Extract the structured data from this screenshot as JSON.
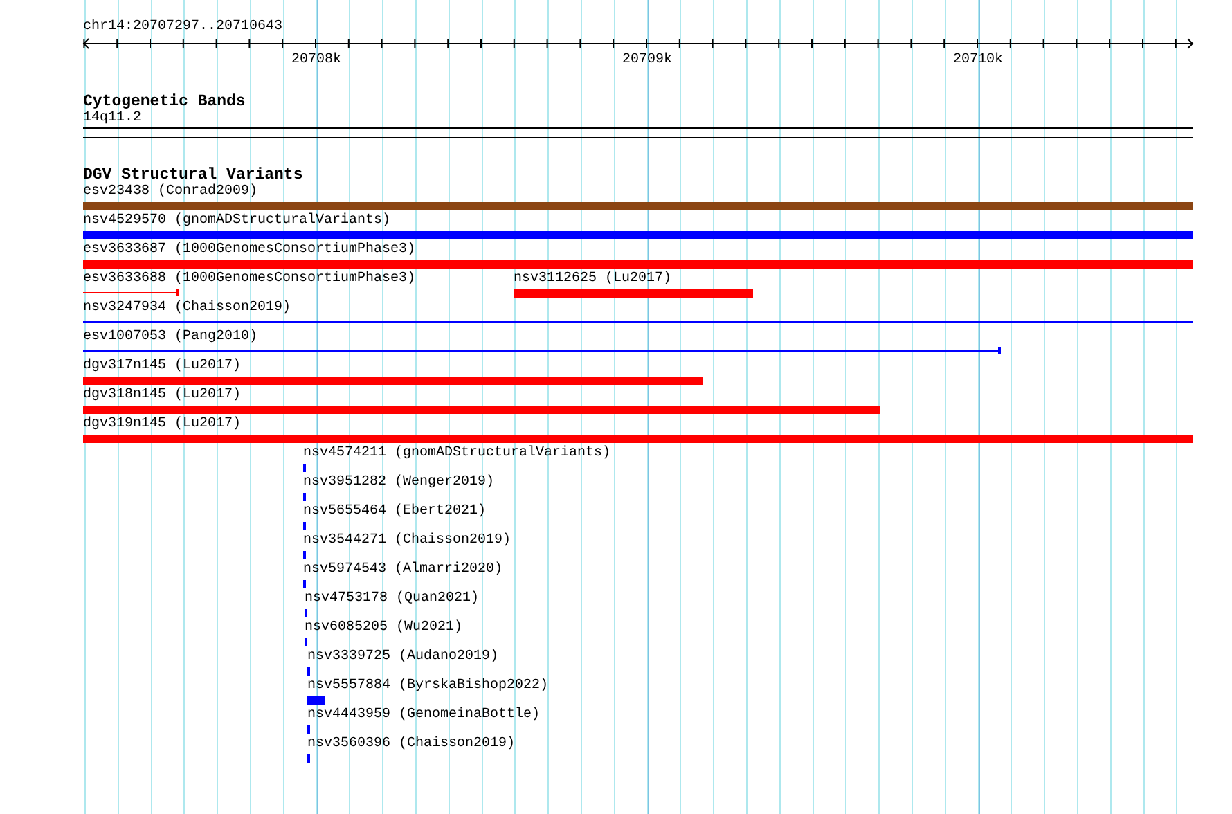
{
  "ruler": {
    "region": "chr14:20707297..20710643",
    "ticks": [
      {
        "label": "20708k"
      },
      {
        "label": "20709k"
      },
      {
        "label": "20710k"
      }
    ]
  },
  "cytogenetic_bands": {
    "title": "Cytogenetic Bands",
    "bands": [
      {
        "label": "14q11.2"
      }
    ]
  },
  "dgv_track": {
    "title": "DGV Structural Variants",
    "rows": [
      {
        "features": [
          {
            "label": "esv23438 (Conrad2009)",
            "kind": "thick",
            "color": "#8b4513"
          }
        ]
      },
      {
        "features": [
          {
            "label": "nsv4529570 (gnomADStructuralVariants)",
            "kind": "thick",
            "color": "#0000ff"
          }
        ]
      },
      {
        "features": [
          {
            "label": "esv3633687 (1000GenomesConsortiumPhase3)",
            "kind": "thick",
            "color": "#ff0000"
          }
        ]
      },
      {
        "features": [
          {
            "label": "esv3633688 (1000GenomesConsortiumPhase3)",
            "kind": "thin",
            "color": "#ff0000"
          },
          {
            "label": "nsv3112625 (Lu2017)",
            "kind": "thick",
            "color": "#ff0000"
          }
        ]
      },
      {
        "features": [
          {
            "label": "nsv3247934 (Chaisson2019)",
            "kind": "thin",
            "color": "#0000ff"
          }
        ]
      },
      {
        "features": [
          {
            "label": "esv1007053 (Pang2010)",
            "kind": "thin",
            "color": "#0000ff"
          }
        ]
      },
      {
        "features": [
          {
            "label": "dgv317n145 (Lu2017)",
            "kind": "thick",
            "color": "#ff0000"
          }
        ]
      },
      {
        "features": [
          {
            "label": "dgv318n145 (Lu2017)",
            "kind": "thick",
            "color": "#ff0000"
          }
        ]
      },
      {
        "features": [
          {
            "label": "dgv319n145 (Lu2017)",
            "kind": "thick",
            "color": "#ff0000"
          }
        ]
      },
      {
        "features": [
          {
            "label": "nsv4574211 (gnomADStructuralVariants)",
            "kind": "thick",
            "color": "#0000ff"
          }
        ]
      },
      {
        "features": [
          {
            "label": "nsv3951282 (Wenger2019)",
            "kind": "thick",
            "color": "#0000ff"
          }
        ]
      },
      {
        "features": [
          {
            "label": "nsv5655464 (Ebert2021)",
            "kind": "thick",
            "color": "#0000ff"
          }
        ]
      },
      {
        "features": [
          {
            "label": "nsv3544271 (Chaisson2019)",
            "kind": "thick",
            "color": "#0000ff"
          }
        ]
      },
      {
        "features": [
          {
            "label": "nsv5974543 (Almarri2020)",
            "kind": "thick",
            "color": "#0000ff"
          }
        ]
      },
      {
        "features": [
          {
            "label": "nsv4753178 (Quan2021)",
            "kind": "thick",
            "color": "#0000ff"
          }
        ]
      },
      {
        "features": [
          {
            "label": "nsv6085205 (Wu2021)",
            "kind": "thick",
            "color": "#0000ff"
          }
        ]
      },
      {
        "features": [
          {
            "label": "nsv3339725 (Audano2019)",
            "kind": "thick",
            "color": "#0000ff"
          }
        ]
      },
      {
        "features": [
          {
            "label": "nsv5557884 (ByrskaBishop2022)",
            "kind": "thick",
            "color": "#0000ff"
          }
        ]
      },
      {
        "features": [
          {
            "label": "nsv4443959 (GenomeinaBottle)",
            "kind": "thick",
            "color": "#0000ff"
          }
        ]
      },
      {
        "features": [
          {
            "label": "nsv3560396 (Chaisson2019)",
            "kind": "thick",
            "color": "#0000ff"
          }
        ]
      }
    ]
  }
}
